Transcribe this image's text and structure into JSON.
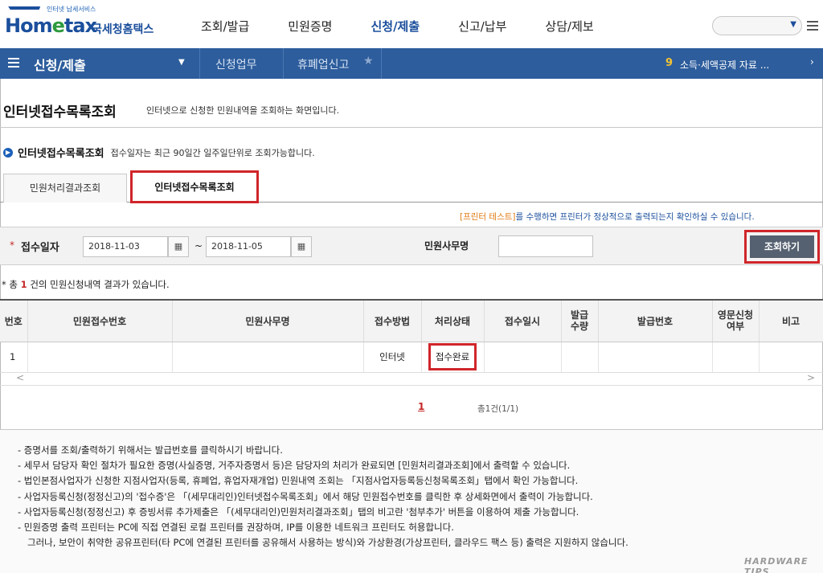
{
  "header": {
    "logo_sub": "인터넷 납세서비스",
    "logo_brand": "Hometax",
    "logo_ko": "국세청홈택스",
    "nav": [
      "조회/발급",
      "민원증명",
      "신청/제출",
      "신고/납부",
      "상담/제보"
    ],
    "active_nav": "신청/제출"
  },
  "breadcrumb": {
    "title": "신청/제출",
    "item1": "신청업무",
    "item2": "휴폐업신고",
    "ticker_num": "9",
    "ticker_text": "소득·세액공제 자료 ..."
  },
  "page": {
    "title": "인터넷접수목록조회",
    "desc": "인터넷으로 신청한 민원내역을 조회하는 화면입니다."
  },
  "section": {
    "title": "인터넷접수목록조회",
    "desc": "접수일자는 최근 90일간 일주일단위로 조회가능합니다."
  },
  "tabs": {
    "tab1": "민원처리결과조회",
    "tab2": "인터넷접수목록조회"
  },
  "notice": {
    "highlight": "[프린터 테스트]",
    "rest": "를 수행하면 프린터가 정상적으로 출력되는지 확인하실 수 있습니다."
  },
  "form": {
    "required_mark": "*",
    "date_label": "접수일자",
    "date_from": "2018-11-03",
    "date_to": "2018-11-05",
    "tilde": "~",
    "office_label": "민원사무명",
    "office_value": "",
    "search_button": "조회하기"
  },
  "result": {
    "prefix": "* 총",
    "count": "1",
    "suffix": "건의 민원신청내역 결과가 있습니다."
  },
  "table": {
    "headers": [
      "번호",
      "민원접수번호",
      "민원사무명",
      "접수방법",
      "처리상태",
      "접수일시",
      "발급\n수량",
      "발급번호",
      "영문신청\n여부",
      "비고"
    ],
    "rows": [
      [
        "1",
        "",
        "",
        "인터넷",
        "접수완료",
        "",
        "",
        "",
        "",
        ""
      ]
    ]
  },
  "pager": {
    "page": "1",
    "info": "총1건(1/1)"
  },
  "notes": [
    "- 증명서를 조회/출력하기 위해서는 발급번호를 클릭하시기 바랍니다.",
    "- 세무서 담당자 확인 절차가 필요한 증명(사실증명, 거주자증명서 등)은 담당자의 처리가 완료되면 [민원처리결과조회]에서 출력할 수 있습니다.",
    "- 법인본점사업자가 신청한 지점사업자(등록, 휴폐업, 휴업자재개업) 민원내역 조회는 「지점사업자등록등신청목록조회」탭에서 확인 가능합니다.",
    "- 사업자등록신청(정정신고)의 '접수증'은 「(세무대리인)인터넷접수목록조회」에서 해당 민원접수번호를 클릭한 후 상세화면에서 출력이 가능합니다.",
    "- 사업자등록신청(정정신고) 후 증빙서류 추가제출은 「(세무대리인)민원처리결과조회」탭의 비고란 '첨부추가' 버튼을 이용하여 제출 가능합니다.",
    "- 민원증명 출력 프린터는 PC에 직접 연결된 로컬 프린터를 권장하며, IP를 이용한 네트워크 프린터도 허용합니다.",
    "그러나, 보안이 취약한 공유프린터(타 PC에 연결된 프린터를 공유해서 사용하는 방식)와 가상환경(가상프린터, 클라우드 팩스 등) 출력은 지원하지 않습니다."
  ],
  "watermark": "HARDWARE TIPS",
  "colors": {
    "brand_blue": "#2d5d9c",
    "highlight_red": "#d0252a",
    "notice_orange": "#e07b12"
  },
  "icons": [
    "search-dropdown-icon",
    "hamburger-menu-icon",
    "calendar-icon",
    "star-icon",
    "chevron-left-icon",
    "chevron-right-icon"
  ]
}
